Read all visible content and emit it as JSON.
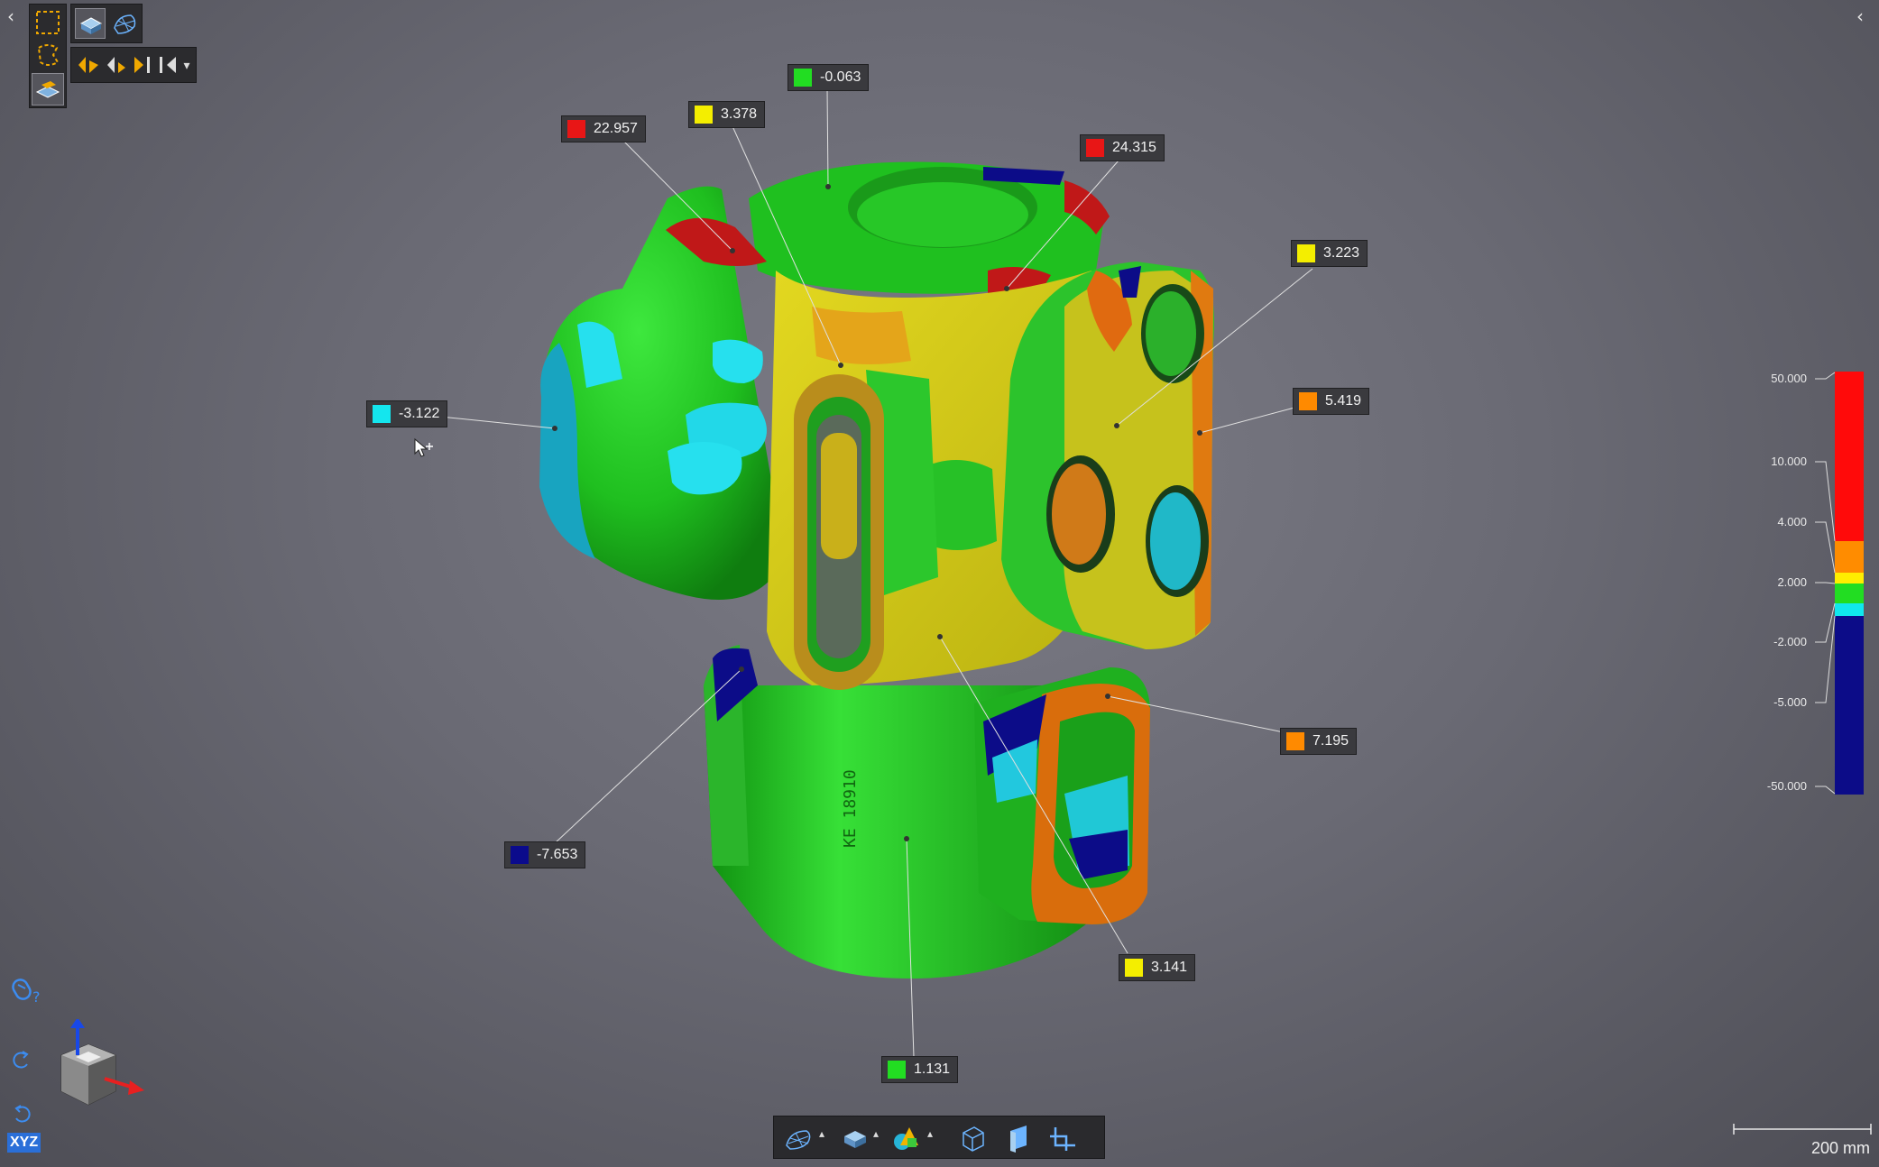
{
  "navigation": {
    "left_arrow": "‹",
    "right_arrow": "‹"
  },
  "toolbar": {
    "selection_tools": [
      "rectangle-select-icon",
      "lasso-select-icon",
      "surface-select-icon"
    ],
    "view_modes": [
      "solid-view-icon",
      "wireframe-view-icon"
    ],
    "navigation_tools": [
      "previous-view-icon",
      "step-back-icon",
      "step-forward-icon",
      "next-view-icon"
    ],
    "dropdown": "▾"
  },
  "annotations": [
    {
      "id": "a1",
      "value": "-0.063",
      "color": "#22dd22"
    },
    {
      "id": "a2",
      "value": "3.378",
      "color": "#f4ee00"
    },
    {
      "id": "a3",
      "value": "22.957",
      "color": "#e81616"
    },
    {
      "id": "a4",
      "value": "24.315",
      "color": "#e81616"
    },
    {
      "id": "a5",
      "value": "3.223",
      "color": "#f4ee00"
    },
    {
      "id": "a6",
      "value": "5.419",
      "color": "#ff8a00"
    },
    {
      "id": "a7",
      "value": "-3.122",
      "color": "#14e6ee"
    },
    {
      "id": "a8",
      "value": "7.195",
      "color": "#ff8a00"
    },
    {
      "id": "a9",
      "value": "-7.653",
      "color": "#0b0b8c"
    },
    {
      "id": "a10",
      "value": "3.141",
      "color": "#f4ee00"
    },
    {
      "id": "a11",
      "value": "1.131",
      "color": "#22dd22"
    }
  ],
  "color_legend": {
    "labels": [
      "50.000",
      "10.000",
      "4.000",
      "2.000",
      "-2.000",
      "-5.000",
      "-50.000"
    ],
    "colors": {
      "red": "#ff0a0a",
      "orange": "#ff8c00",
      "yellow": "#ffee00",
      "green": "#22dd22",
      "cyan": "#10e8ee",
      "blue": "#0c0c88"
    }
  },
  "part_engraving": "KE 18910",
  "scale_bar": {
    "label": "200 mm"
  },
  "view_cube": {
    "label": "XYZ",
    "mouse_help": "?"
  },
  "bottom_toolbar": {
    "buttons": [
      "mesh-display-icon",
      "solid-display-icon",
      "primitives-icon",
      "bounding-box-icon",
      "clipping-plane-icon",
      "section-icon"
    ],
    "dropdown": "▴"
  }
}
